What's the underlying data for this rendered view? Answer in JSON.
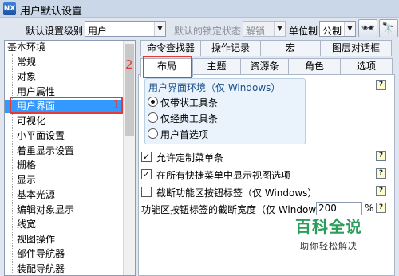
{
  "window": {
    "title": "用户默认设置",
    "app_icon": "NX"
  },
  "toolbar": {
    "level_label": "默认设置级别",
    "level_value": "用户",
    "lock_label": "默认的锁定状态",
    "lock_value": "解锁",
    "unit_label": "单位制",
    "unit_value": "公制",
    "button_icons": [
      "manage-defaults-icon",
      "find-defaults-icon"
    ]
  },
  "tree": {
    "items": [
      {
        "label": "基本环境",
        "level": 0
      },
      {
        "label": "常规",
        "level": 1
      },
      {
        "label": "对象",
        "level": 1
      },
      {
        "label": "用户属性",
        "level": 1
      },
      {
        "label": "用户界面",
        "level": 1,
        "selected": true
      },
      {
        "label": "可视化",
        "level": 1
      },
      {
        "label": "小平面设置",
        "level": 1
      },
      {
        "label": "着重显示设置",
        "level": 1
      },
      {
        "label": "栅格",
        "level": 1
      },
      {
        "label": "显示",
        "level": 1
      },
      {
        "label": "基本光源",
        "level": 1
      },
      {
        "label": "编辑对象显示",
        "level": 1
      },
      {
        "label": "线宽",
        "level": 1
      },
      {
        "label": "视图操作",
        "level": 1
      },
      {
        "label": "部件导航器",
        "level": 1
      },
      {
        "label": "装配导航器",
        "level": 1
      }
    ],
    "selection_color": "#3399ff"
  },
  "annotations": {
    "marker_1": "1",
    "marker_2": "2",
    "color": "#e53935"
  },
  "tabs": {
    "row1": [
      "命令查找器",
      "操作记录",
      "宏",
      "图层对话框"
    ],
    "row2": [
      "布局",
      "主题",
      "资源条",
      "角色",
      "选项"
    ],
    "active": "布局"
  },
  "layout_tab": {
    "group_title": "用户界面环境（仅 Windows）",
    "radios": [
      {
        "label": "仅带状工具条",
        "checked": true
      },
      {
        "label": "仅经典工具条",
        "checked": false
      },
      {
        "label": "用户首选项",
        "checked": false
      }
    ],
    "checks": [
      {
        "label": "允许定制菜单条",
        "checked": true
      },
      {
        "label": "在所有快捷菜单中显示视图选项",
        "checked": true
      },
      {
        "label": "截断功能区按钮标签（仅 Windows）",
        "checked": false
      }
    ],
    "width_label": "功能区按钮标签的截断宽度（仅 Window",
    "width_value": "200",
    "width_unit": "%",
    "help_icon": "help-icon",
    "help_text": "?"
  },
  "watermark": {
    "title": "百科全说",
    "subtitle": "助你轻松解决"
  }
}
